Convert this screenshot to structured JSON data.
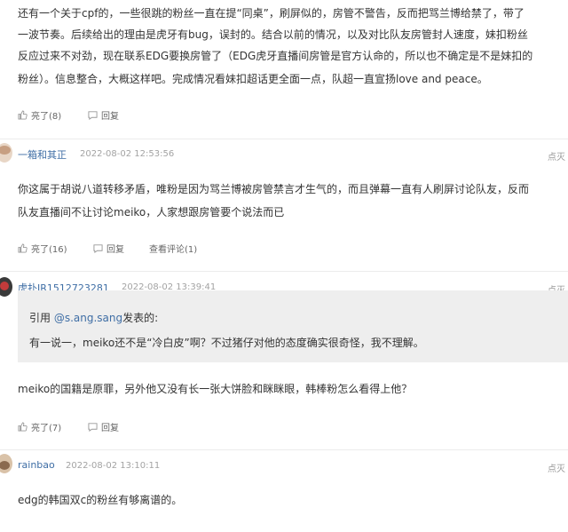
{
  "comment0": {
    "lines": [
      "还有一个关于cpf的，一些很跳的粉丝一直在提“同桌”，刷屏似的，房管不警告，反而把骂兰博给禁了，带了",
      "一波节奏。后续给出的理由是虎牙有bug，误封的。结合以前的情况，以及对比队友房管封人速度，妹扣粉丝",
      "反应过来不对劲，现在联系EDG要换房管了（EDG虎牙直播间房管是官方认命的，所以也不确定是不是妹扣的",
      "粉丝）。信息整合，大概这样吧。完成情况看妹扣超话更全面一点，队超一直宣扬love and peace。"
    ],
    "like": "亮了(8)",
    "reply": "回复"
  },
  "comment1": {
    "author": "一箱和其正",
    "time": "2022-08-02 12:53:56",
    "report": "点灭",
    "lines": [
      "你这属于胡说八道转移矛盾，唯粉是因为骂兰博被房管禁言才生气的，而且弹幕一直有人刷屏讨论队友，反而",
      "队友直播间不让讨论meiko，人家想跟房管要个说法而已"
    ],
    "like": "亮了(16)",
    "reply": "回复",
    "view": "查看评论(1)"
  },
  "comment2": {
    "author": "虎扑JR1512723281",
    "time": "2022-08-02 13:39:41",
    "report": "点灭",
    "quote": {
      "prefix": "引用 ",
      "user": "@s.ang.sang",
      "suffix": "发表的:",
      "text": "有一说一，meiko还不是“冷白皮”啊？不过猪仔对他的态度确实很奇怪，我不理解。"
    },
    "body": "meiko的国籍是原罪，另外他又没有长一张大饼脸和眯眯眼，韩棒粉怎么看得上他？",
    "like": "亮了(7)",
    "reply": "回复"
  },
  "comment3": {
    "author": "rainbao",
    "time": "2022-08-02 13:10:11",
    "report": "点灭",
    "body": "edg的韩国双c的粉丝有够离谱的。"
  }
}
